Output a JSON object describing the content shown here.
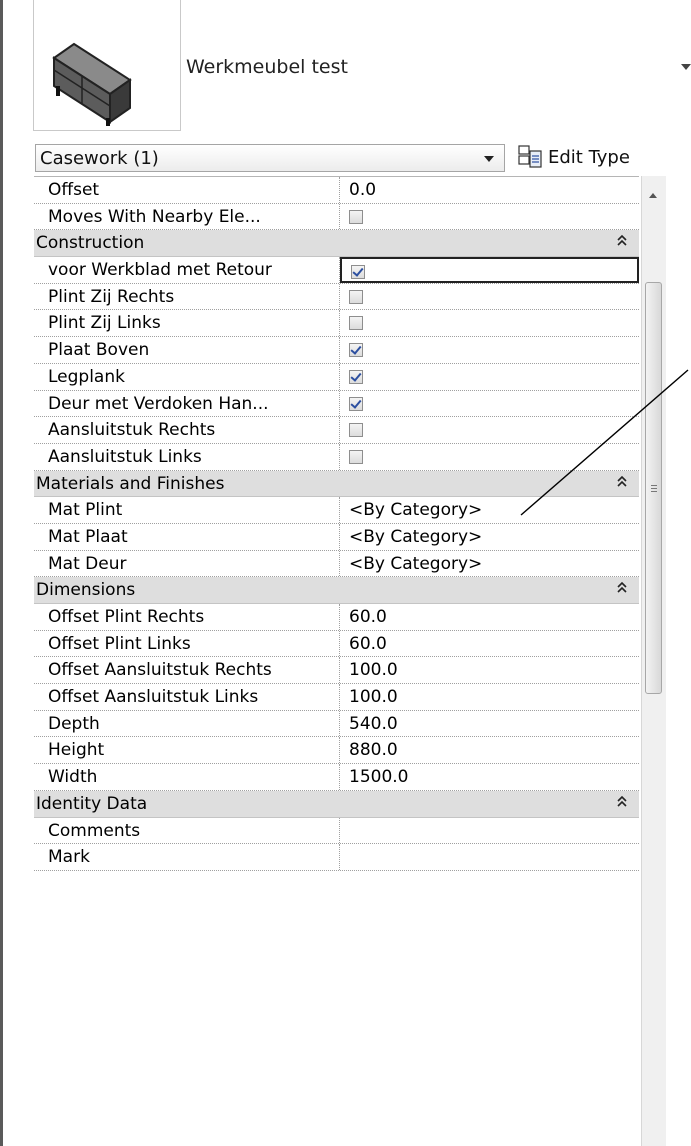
{
  "header": {
    "type_name": "Werkmeubel test"
  },
  "selector": {
    "category": "Casework (1)",
    "edit_type_label": "Edit Type"
  },
  "rows": [
    {
      "kind": "prop",
      "name": "Offset",
      "value": "0.0"
    },
    {
      "kind": "prop",
      "name": "Moves With Nearby Ele...",
      "checkbox": true,
      "checked": false
    },
    {
      "kind": "group",
      "name": "Construction"
    },
    {
      "kind": "prop",
      "name": "voor Werkblad met Retour",
      "checkbox": true,
      "checked": true,
      "active": true
    },
    {
      "kind": "prop",
      "name": "Plint Zij Rechts",
      "checkbox": true,
      "checked": false
    },
    {
      "kind": "prop",
      "name": "Plint Zij Links",
      "checkbox": true,
      "checked": false
    },
    {
      "kind": "prop",
      "name": "Plaat Boven",
      "checkbox": true,
      "checked": true
    },
    {
      "kind": "prop",
      "name": "Legplank",
      "checkbox": true,
      "checked": true
    },
    {
      "kind": "prop",
      "name": "Deur met Verdoken Han...",
      "checkbox": true,
      "checked": true
    },
    {
      "kind": "prop",
      "name": "Aansluitstuk Rechts",
      "checkbox": true,
      "checked": false
    },
    {
      "kind": "prop",
      "name": "Aansluitstuk Links",
      "checkbox": true,
      "checked": false
    },
    {
      "kind": "group",
      "name": "Materials and Finishes"
    },
    {
      "kind": "prop",
      "name": "Mat Plint",
      "value": "<By Category>"
    },
    {
      "kind": "prop",
      "name": "Mat Plaat",
      "value": "<By Category>"
    },
    {
      "kind": "prop",
      "name": "Mat Deur",
      "value": "<By Category>"
    },
    {
      "kind": "group",
      "name": "Dimensions"
    },
    {
      "kind": "prop",
      "name": "Offset Plint Rechts",
      "value": "60.0"
    },
    {
      "kind": "prop",
      "name": "Offset Plint Links",
      "value": "60.0"
    },
    {
      "kind": "prop",
      "name": "Offset Aansluitstuk Rechts",
      "value": "100.0"
    },
    {
      "kind": "prop",
      "name": "Offset Aansluitstuk Links",
      "value": "100.0"
    },
    {
      "kind": "prop",
      "name": "Depth",
      "value": "540.0"
    },
    {
      "kind": "prop",
      "name": "Height",
      "value": "880.0"
    },
    {
      "kind": "prop",
      "name": "Width",
      "value": "1500.0"
    },
    {
      "kind": "group",
      "name": "Identity Data"
    },
    {
      "kind": "prop",
      "name": "Comments",
      "value": ""
    },
    {
      "kind": "prop",
      "name": "Mark",
      "value": ""
    }
  ],
  "icons": {
    "type_thumbnail": "casework-cabinet-icon",
    "type_dropdown": "chevron-down-icon",
    "edit_type": "edit-type-icon",
    "collapse": "collapse-chevrons-icon",
    "checkbox_check": "checkmark-icon"
  },
  "colors": {
    "group_header_bg": "#dedede",
    "checkmark": "#2c4fa0",
    "panel_border": "#5a5a5a"
  }
}
